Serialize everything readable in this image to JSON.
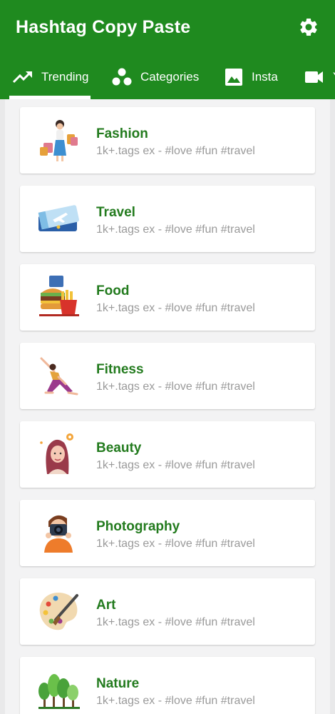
{
  "app": {
    "title": "Hashtag Copy Paste",
    "settings_icon": "gear-icon"
  },
  "tabs": [
    {
      "label": "Trending",
      "icon": "trending-up-icon",
      "selected": true
    },
    {
      "label": "Categories",
      "icon": "categories-dots-icon",
      "selected": false
    },
    {
      "label": "Insta",
      "icon": "image-icon",
      "selected": false
    },
    {
      "label": "Y",
      "icon": "video-icon",
      "selected": false
    }
  ],
  "categories": [
    {
      "name": "Fashion",
      "subtitle": "1k+.tags ex - #love #fun #travel",
      "icon": "fashion-shopping-icon"
    },
    {
      "name": "Travel",
      "subtitle": "1k+.tags ex - #love #fun #travel",
      "icon": "plane-ticket-icon"
    },
    {
      "name": "Food",
      "subtitle": "1k+.tags ex - #love #fun #travel",
      "icon": "burger-fries-icon"
    },
    {
      "name": "Fitness",
      "subtitle": "1k+.tags ex - #love #fun #travel",
      "icon": "yoga-pose-icon"
    },
    {
      "name": "Beauty",
      "subtitle": "1k+.tags ex - #love #fun #travel",
      "icon": "beauty-woman-icon"
    },
    {
      "name": "Photography",
      "subtitle": "1k+.tags ex - #love #fun #travel",
      "icon": "photographer-icon"
    },
    {
      "name": "Art",
      "subtitle": "1k+.tags ex - #love #fun #travel",
      "icon": "paint-palette-icon"
    },
    {
      "name": "Nature",
      "subtitle": "1k+.tags ex - #love #fun #travel",
      "icon": "trees-icon"
    }
  ],
  "colors": {
    "primary": "#1f8a1f",
    "title_text": "#237b1e",
    "subtitle_text": "#9a9a9a"
  }
}
